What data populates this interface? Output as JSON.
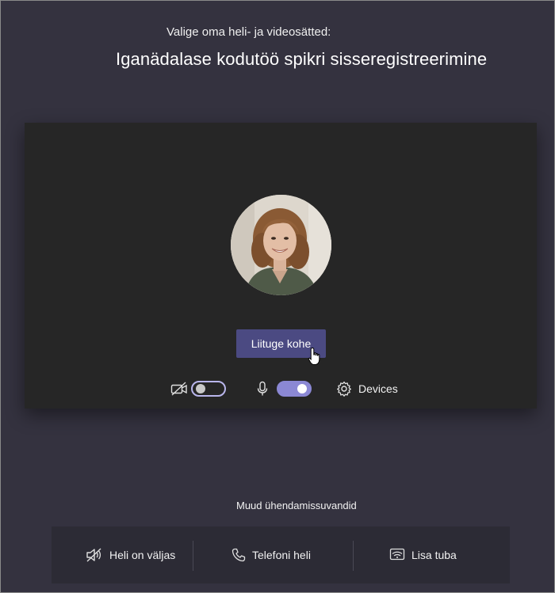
{
  "header": {
    "subtitle": "Valige oma heli- ja videosätted:",
    "title": "Iganädalase kodutöö spikri sisseregistreerimine"
  },
  "preview": {
    "join_label": "Liituge kohe",
    "video_toggle": {
      "icon": "camera-off-icon",
      "on": false
    },
    "mic_toggle": {
      "icon": "microphone-icon",
      "on": true
    },
    "devices": {
      "icon": "gear-icon",
      "label": "Devices"
    }
  },
  "other_options": {
    "label": "Muud ühendamissuvandid",
    "items": [
      {
        "icon": "speaker-off-icon",
        "label": "Heli on väljas"
      },
      {
        "icon": "phone-icon",
        "label": "Telefoni heli"
      },
      {
        "icon": "cast-room-icon",
        "label": "Lisa tuba"
      }
    ]
  },
  "colors": {
    "background": "#34323f",
    "stage": "#262626",
    "accent": "#4b4a82",
    "toggle_on": "#8b88d4",
    "toggle_off_border": "#b9b6ec"
  }
}
